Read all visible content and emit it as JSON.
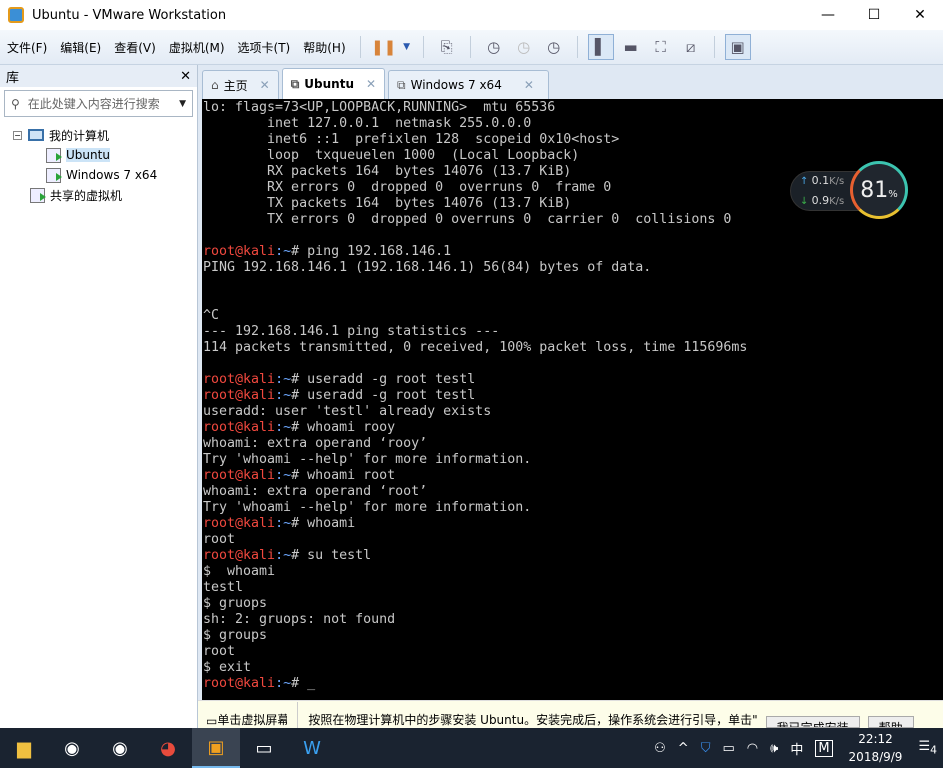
{
  "window": {
    "title": "Ubuntu - VMware Workstation",
    "minimize": "—",
    "maximize": "☐",
    "close": "✕"
  },
  "menu": [
    "文件(F)",
    "编辑(E)",
    "查看(V)",
    "虚拟机(M)",
    "选项卡(T)",
    "帮助(H)"
  ],
  "toolbar": {
    "icons": [
      "pause-icon",
      "dropdown-icon",
      "send-ctrl-alt-del-icon",
      "snapshot-take-icon",
      "snapshot-revert-icon",
      "snapshot-manager-icon",
      "library-view-icon",
      "thumbnail-bar-icon",
      "fullscreen-icon",
      "unity-icon",
      "console-view-icon"
    ]
  },
  "sidebar": {
    "title": "库",
    "close": "✕",
    "search_placeholder": "在此处键入内容进行搜索",
    "tree": {
      "root": "我的计算机",
      "vms": [
        "Ubuntu",
        "Windows 7 x64"
      ],
      "shared": "共享的虚拟机"
    }
  },
  "tabs": [
    {
      "label": "主页",
      "icon": "home-icon"
    },
    {
      "label": "Ubuntu",
      "icon": "vm-icon",
      "active": true
    },
    {
      "label": "Windows 7 x64",
      "icon": "vm-icon"
    }
  ],
  "tab_close": "✕",
  "terminal": {
    "prompt_user": "root@kali",
    "prompt_path": ":~",
    "prompt_sym": "# ",
    "lines": [
      {
        "t": "lo: flags=73<UP,LOOPBACK,RUNNING>  mtu 65536"
      },
      {
        "t": "        inet 127.0.0.1  netmask 255.0.0.0"
      },
      {
        "t": "        inet6 ::1  prefixlen 128  scopeid 0x10<host>"
      },
      {
        "t": "        loop  txqueuelen 1000  (Local Loopback)"
      },
      {
        "t": "        RX packets 164  bytes 14076 (13.7 KiB)"
      },
      {
        "t": "        RX errors 0  dropped 0  overruns 0  frame 0"
      },
      {
        "t": "        TX packets 164  bytes 14076 (13.7 KiB)"
      },
      {
        "t": "        TX errors 0  dropped 0 overruns 0  carrier 0  collisions 0"
      },
      {
        "t": ""
      },
      {
        "p": true,
        "t": "ping 192.168.146.1"
      },
      {
        "t": "PING 192.168.146.1 (192.168.146.1) 56(84) bytes of data."
      },
      {
        "t": ""
      },
      {
        "t": ""
      },
      {
        "t": "^C"
      },
      {
        "t": "--- 192.168.146.1 ping statistics ---"
      },
      {
        "t": "114 packets transmitted, 0 received, 100% packet loss, time 115696ms"
      },
      {
        "t": ""
      },
      {
        "p": true,
        "t": "useradd -g root testl"
      },
      {
        "p": true,
        "t": "useradd -g root testl"
      },
      {
        "t": "useradd: user 'testl' already exists"
      },
      {
        "p": true,
        "t": "whoami rooy"
      },
      {
        "t": "whoami: extra operand ‘rooy’"
      },
      {
        "t": "Try 'whoami --help' for more information."
      },
      {
        "p": true,
        "t": "whoami root"
      },
      {
        "t": "whoami: extra operand ‘root’"
      },
      {
        "t": "Try 'whoami --help' for more information."
      },
      {
        "p": true,
        "t": "whoami"
      },
      {
        "t": "root"
      },
      {
        "p": true,
        "t": "su testl"
      },
      {
        "t": "$  whoami"
      },
      {
        "t": "testl"
      },
      {
        "t": "$ gruops"
      },
      {
        "t": "sh: 2: gruops: not found"
      },
      {
        "t": "$ groups"
      },
      {
        "t": "root"
      },
      {
        "t": "$ exit"
      },
      {
        "p": true,
        "t": "_"
      }
    ]
  },
  "monitor": {
    "up": "0.1",
    "down": "0.9",
    "unit": "K/s",
    "percent": "81",
    "pct_sign": "%"
  },
  "hint": {
    "left": "单击虚拟屏幕",
    "text": "按照在物理计算机中的步骤安装 Ubuntu。安装完成后，操作系统会进行引导，单击\"",
    "done_button": "我已完成安装",
    "help_button": "帮助"
  },
  "taskbar": {
    "apps": [
      "file-explorer-icon",
      "steam-icon",
      "steam-icon",
      "chrome-icon",
      "vmware-icon",
      "cmd-icon",
      "wps-icon"
    ],
    "ime": "中",
    "ime2": "M",
    "time": "22:12",
    "date": "2018/9/9",
    "notifications": "4"
  },
  "colors": {
    "prompt_user": "#f0483e",
    "prompt_path": "#6ea8ff",
    "terminal_bg": "#000000"
  }
}
